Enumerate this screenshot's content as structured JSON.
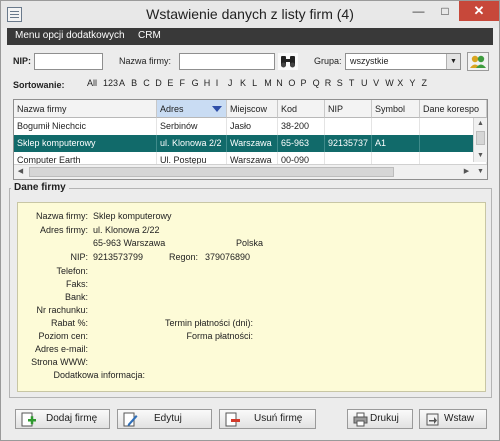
{
  "window": {
    "title": "Wstawienie danych z listy firm (4)"
  },
  "menu": {
    "items": [
      "Menu opcji dodatkowych",
      "CRM"
    ]
  },
  "filters": {
    "nip_label": "NIP:",
    "nip_value": "",
    "name_label": "Nazwa firmy:",
    "name_value": "",
    "group_label": "Grupa:",
    "group_value": "wszystkie"
  },
  "sorting": {
    "label": "Sortowanie:",
    "letters": [
      "All",
      "123",
      "A",
      "B",
      "C",
      "D",
      "E",
      "F",
      "G",
      "H",
      "I",
      "J",
      "K",
      "L",
      "M",
      "N",
      "O",
      "P",
      "Q",
      "R",
      "S",
      "T",
      "U",
      "V",
      "W",
      "X",
      "Y",
      "Z"
    ]
  },
  "grid": {
    "columns": [
      "Nazwa firmy",
      "Adres",
      "Miejscow",
      "Kod",
      "NIP",
      "Symbol",
      "Dane korespo"
    ],
    "rows": [
      [
        "Bogumił Niechcic",
        "Serbinów",
        "Jasło",
        "38-200",
        "",
        "",
        ""
      ],
      [
        "Sklep komputerowy",
        "ul. Klonowa 2/2",
        "Warszawa",
        "65-963",
        "92135737",
        "A1",
        ""
      ],
      [
        "Computer Earth",
        "Ul. Postępu",
        "Warszawa",
        "00-090",
        "",
        "",
        ""
      ]
    ],
    "selected_row": 1
  },
  "details": {
    "section_title": "Dane firmy",
    "labels": {
      "name": "Nazwa firmy:",
      "address": "Adres firmy:",
      "nip": "NIP:",
      "phone": "Telefon:",
      "fax": "Faks:",
      "bank": "Bank:",
      "account": "Nr rachunku:",
      "discount": "Rabat %:",
      "price_level": "Poziom cen:",
      "email": "Adres e-mail:",
      "www": "Strona WWW:",
      "extra": "Dodatkowa informacja:",
      "regon": "Regon:",
      "payment_term": "Termin płatności (dni):",
      "payment_form": "Forma płatności:"
    },
    "values": {
      "name": "Sklep komputerowy",
      "address_line1": "ul. Klonowa 2/22",
      "address_line2": "65-963 Warszawa",
      "country": "Polska",
      "nip": "9213573799",
      "regon": "379076890"
    }
  },
  "buttons": {
    "add": "Dodaj firmę",
    "edit": "Edytuj",
    "delete": "Usuń firmę",
    "print": "Drukuj",
    "insert": "Wstaw"
  }
}
